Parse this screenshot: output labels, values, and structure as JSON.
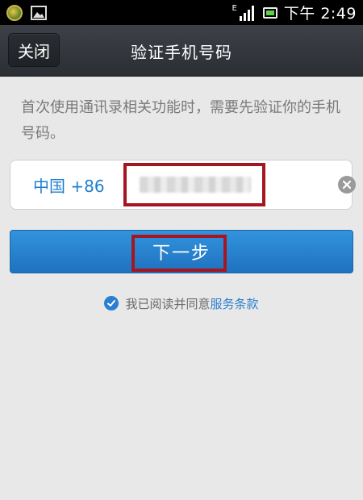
{
  "status_bar": {
    "network_type": "E",
    "time": "下午 2:49",
    "icons": [
      "app-notification-icon",
      "gallery-icon",
      "signal-icon",
      "battery-icon"
    ]
  },
  "header": {
    "close_label": "关闭",
    "title": "验证手机号码"
  },
  "main": {
    "description": "首次使用通讯录相关功能时，需要先验证你的手机号码。",
    "country_code": "中国 +86",
    "phone_value": "",
    "next_label": "下一步"
  },
  "agreement": {
    "text": "我已阅读并同意",
    "terms_link": "服务条款",
    "checked": true
  },
  "colors": {
    "accent": "#1f72c0",
    "link": "#2b7fd0",
    "highlight": "#a51620",
    "title_bar": "#2b2e33"
  }
}
